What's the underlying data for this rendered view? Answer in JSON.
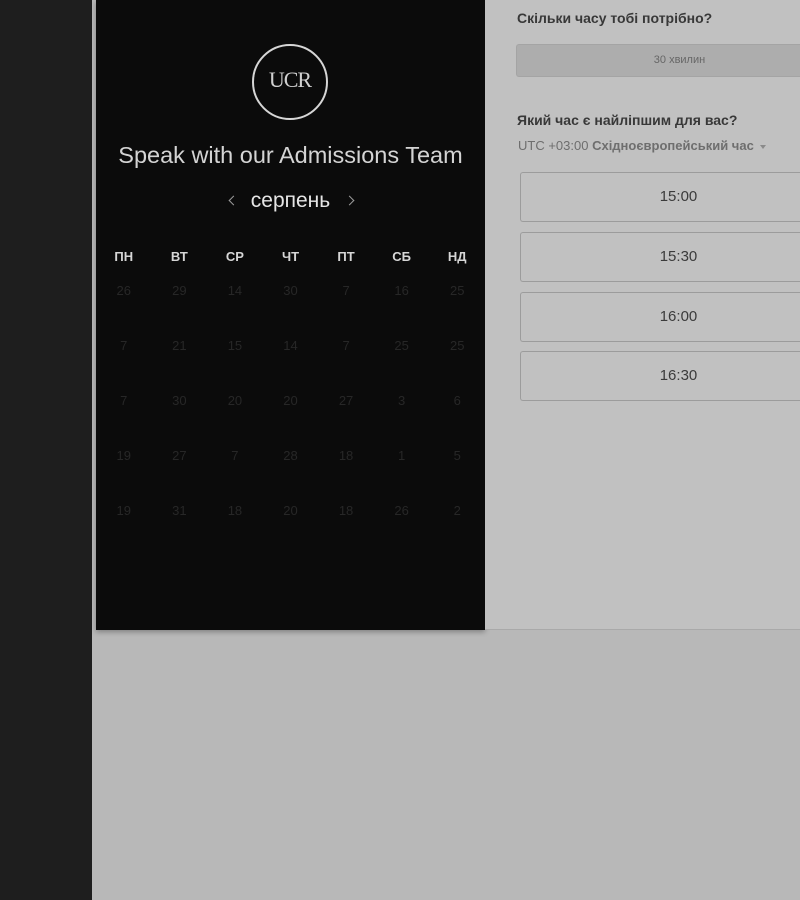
{
  "theme": {
    "sidebar_bg": "#1e1e1e",
    "backdrop_bg": "#b8b8b8",
    "calendar_panel_bg": "#0b0b0b",
    "details_panel_bg": "#c1c1c1"
  },
  "icons": {
    "prev_month": "chevron-left-icon",
    "next_month": "chevron-right-icon",
    "timezone_toggle": "caret-down-icon"
  },
  "booking": {
    "logo_text": "UCR",
    "title": "Speak with our Admissions Team",
    "calendar": {
      "month": "серпень",
      "weekdays": [
        "ПН",
        "ВТ",
        "СР",
        "ЧТ",
        "ПТ",
        "СБ",
        "НД"
      ],
      "weeks": [
        [
          26,
          29,
          14,
          30,
          7,
          16,
          25
        ],
        [
          7,
          21,
          15,
          14,
          7,
          25,
          25
        ],
        [
          7,
          30,
          20,
          20,
          27,
          3,
          6
        ],
        [
          19,
          27,
          7,
          28,
          18,
          1,
          5
        ],
        [
          19,
          31,
          18,
          20,
          18,
          26,
          2
        ]
      ]
    }
  },
  "details": {
    "duration_heading": "Скільки часу тобі потрібно?",
    "duration_option": "30 хвилин",
    "time_heading": "Який час є найліпшим для вас?",
    "timezone": {
      "offset": "UTC +03:00",
      "name": "Східноєвропейський час"
    },
    "slots": [
      "15:00",
      "15:30",
      "16:00",
      "16:30"
    ]
  }
}
